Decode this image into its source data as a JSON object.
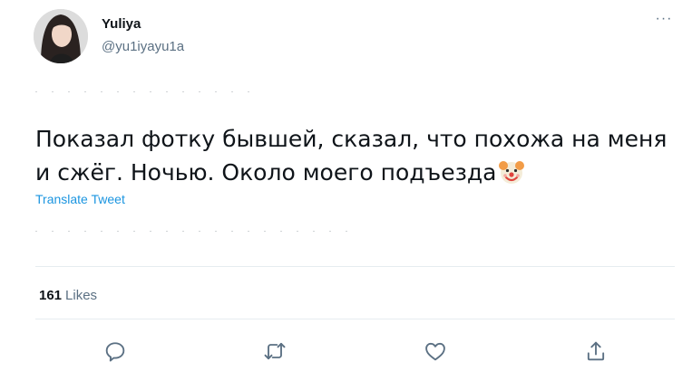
{
  "author": {
    "display_name": "Yuliya",
    "handle": "@yu1iyayu1a"
  },
  "tweet": {
    "text": "Показал фотку бывшей, сказал, что похожа на меня и сжёг. Ночью. Около моего подъезда",
    "emoji": "clown-face-icon",
    "translate_label": "Translate Tweet"
  },
  "stats": {
    "likes_count": "161",
    "likes_label": "Likes"
  },
  "actions": {
    "more_label": "···"
  },
  "colors": {
    "text": "#0f1419",
    "secondary": "#5b7083",
    "link": "#1b95e0",
    "divider": "#e6ecf0"
  }
}
